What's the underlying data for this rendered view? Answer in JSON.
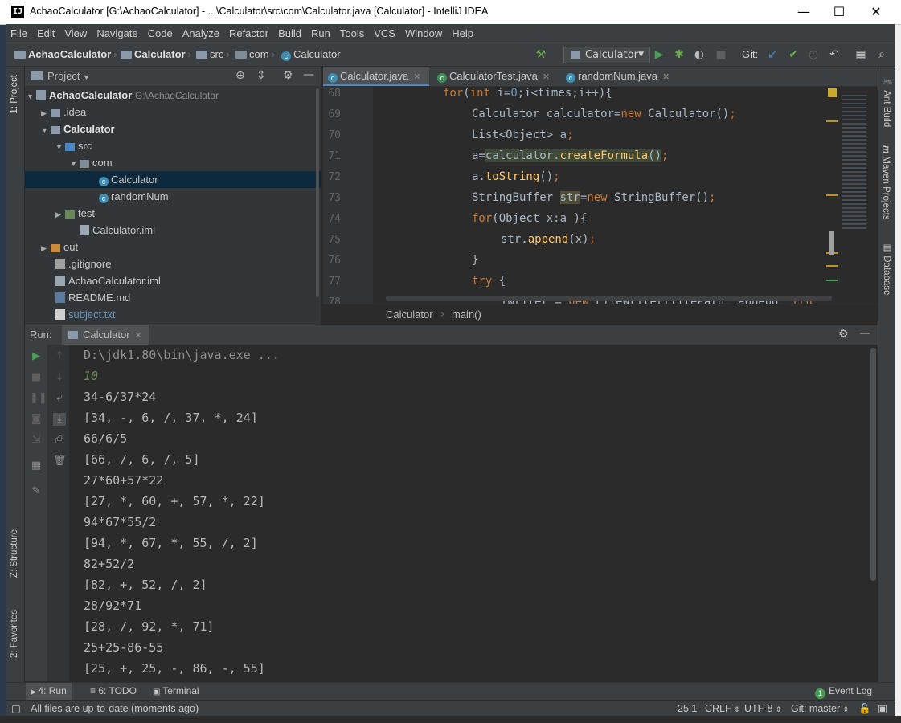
{
  "window": {
    "title": "AchaoCalculator [G:\\AchaoCalculator] - ...\\Calculator\\src\\com\\Calculator.java [Calculator] - IntelliJ IDEA",
    "app_icon": "IJ",
    "minimize": "—",
    "maximize": "☐",
    "close": "✕"
  },
  "menu": [
    "File",
    "Edit",
    "View",
    "Navigate",
    "Code",
    "Analyze",
    "Refactor",
    "Build",
    "Run",
    "Tools",
    "VCS",
    "Window",
    "Help"
  ],
  "navbar": {
    "crumbs": [
      "AchaoCalculator",
      "Calculator",
      "src",
      "com",
      "Calculator"
    ],
    "run_config": "Calculator",
    "git_label": "Git:"
  },
  "left_strip": {
    "project": "1: Project",
    "structure": "Z: Structure",
    "favorites": "2: Favorites"
  },
  "right_strip": {
    "ant": "Ant Build",
    "maven": "Maven Projects",
    "database": "Database"
  },
  "project": {
    "header": "Project",
    "root_name": "AchaoCalculator",
    "root_path": "G:\\AchaoCalculator",
    "items": [
      ".idea",
      "Calculator",
      "src",
      "com",
      "Calculator",
      "randomNum",
      "test",
      "Calculator.iml",
      "out",
      ".gitignore",
      "AchaoCalculator.iml",
      "README.md",
      "subject.txt"
    ]
  },
  "editor": {
    "tabs": [
      "Calculator.java",
      "CalculatorTest.java",
      "randomNum.java"
    ],
    "line_numbers": [
      "68",
      "69",
      "70",
      "71",
      "72",
      "73",
      "74",
      "75",
      "76",
      "77",
      "78"
    ],
    "breadcrumb": [
      "Calculator",
      "main()"
    ]
  },
  "run": {
    "label": "Run:",
    "tab": "Calculator",
    "output": [
      "D:\\jdk1.80\\bin\\java.exe ...",
      "10",
      "34-6/37*24",
      "[34, -, 6, /, 37, *, 24]",
      "66/6/5",
      "[66, /, 6, /, 5]",
      "27*60+57*22",
      "[27, *, 60, +, 57, *, 22]",
      "94*67*55/2",
      "[94, *, 67, *, 55, /, 2]",
      "82+52/2",
      "[82, +, 52, /, 2]",
      "28/92*71",
      "[28, /, 92, *, 71]",
      "25+25-86-55",
      "[25, +, 25, -, 86, -, 55]"
    ]
  },
  "bottom_tabs": {
    "run": "4: Run",
    "todo": "6: TODO",
    "terminal": "Terminal",
    "event_log": "Event Log",
    "event_count": "1"
  },
  "status": {
    "message": "All files are up-to-date (moments ago)",
    "position": "25:1",
    "line_sep": "CRLF",
    "encoding": "UTF-8",
    "git": "Git: master"
  },
  "colors": {
    "accent": "#4a88c7",
    "keyword": "#cc7832",
    "number": "#6897bb",
    "method": "#ffc66d",
    "run_green": "#499c54"
  }
}
